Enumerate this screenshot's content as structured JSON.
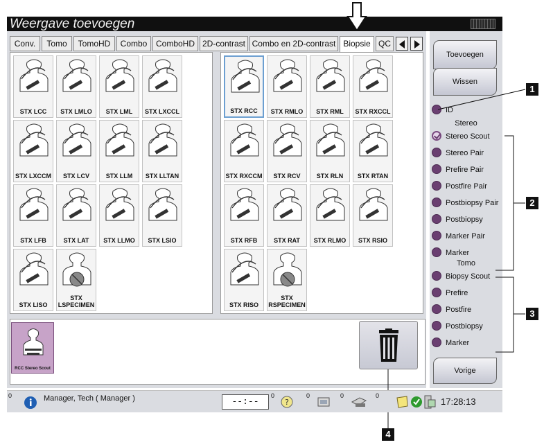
{
  "window": {
    "title": "Weergave toevoegen"
  },
  "tabs": [
    {
      "label": "Conv.",
      "active": false
    },
    {
      "label": "Tomo",
      "active": false
    },
    {
      "label": "TomoHD",
      "active": false
    },
    {
      "label": "Combo",
      "active": false
    },
    {
      "label": "ComboHD",
      "active": false
    },
    {
      "label": "2D-contrast",
      "active": false
    },
    {
      "label": "Combo en 2D-contrast",
      "active": false
    },
    {
      "label": "Biopsie",
      "active": true
    },
    {
      "label": "QC",
      "active": false
    }
  ],
  "left_views": [
    {
      "label": "STX LCC",
      "icon": "breast-compression-cc-icon"
    },
    {
      "label": "STX LMLO",
      "icon": "breast-compression-mlo-icon"
    },
    {
      "label": "STX LML",
      "icon": "breast-compression-ml-icon"
    },
    {
      "label": "STX LXCCL",
      "icon": "breast-compression-xccl-icon"
    },
    {
      "label": "STX LXCCM",
      "icon": "breast-compression-xccm-icon"
    },
    {
      "label": "STX LCV",
      "icon": "breast-compression-cv-icon"
    },
    {
      "label": "STX LLM",
      "icon": "breast-compression-lm-icon"
    },
    {
      "label": "STX LLTAN",
      "icon": "breast-compression-tan-icon"
    },
    {
      "label": "STX LFB",
      "icon": "breast-compression-fb-icon"
    },
    {
      "label": "STX LAT",
      "icon": "breast-compression-lat-icon"
    },
    {
      "label": "STX LLMO",
      "icon": "breast-compression-lmo-icon"
    },
    {
      "label": "STX LSIO",
      "icon": "breast-compression-sio-icon"
    },
    {
      "label": "STX LISO",
      "icon": "breast-compression-iso-icon"
    },
    {
      "label": "STX LSPECIMEN",
      "icon": "specimen-icon"
    }
  ],
  "right_views": [
    {
      "label": "STX RCC",
      "icon": "breast-compression-cc-icon",
      "selected": true
    },
    {
      "label": "STX RMLO",
      "icon": "breast-compression-mlo-icon"
    },
    {
      "label": "STX RML",
      "icon": "breast-compression-ml-icon"
    },
    {
      "label": "STX RXCCL",
      "icon": "breast-compression-xccl-icon"
    },
    {
      "label": "STX RXCCM",
      "icon": "breast-compression-xccm-icon"
    },
    {
      "label": "STX RCV",
      "icon": "breast-compression-cv-icon"
    },
    {
      "label": "STX RLN",
      "icon": "breast-compression-lm-icon"
    },
    {
      "label": "STX RTAN",
      "icon": "breast-compression-tan-icon"
    },
    {
      "label": "STX RFB",
      "icon": "breast-compression-fb-icon"
    },
    {
      "label": "STX RAT",
      "icon": "breast-compression-lat-icon"
    },
    {
      "label": "STX RLMO",
      "icon": "breast-compression-lmo-icon"
    },
    {
      "label": "STX RSIO",
      "icon": "breast-compression-sio-icon"
    },
    {
      "label": "STX RISO",
      "icon": "breast-compression-iso-icon"
    },
    {
      "label": "STX RSPECIMEN",
      "icon": "specimen-icon"
    }
  ],
  "added_view": {
    "label": "RCC Stereo Scout"
  },
  "buttons": {
    "add": "Toevoegen",
    "clear": "Wissen",
    "back": "Vorige"
  },
  "options": {
    "id_label": "ID",
    "stereo_header": "Stereo",
    "stereo": [
      {
        "label": "Stereo Scout",
        "checked": true
      },
      {
        "label": "Stereo Pair",
        "checked": false
      },
      {
        "label": "Prefire Pair",
        "checked": false
      },
      {
        "label": "Postfire Pair",
        "checked": false
      },
      {
        "label": "Postbiopsy Pair",
        "checked": false
      },
      {
        "label": "Postbiopsy",
        "checked": false
      },
      {
        "label": "Marker Pair",
        "checked": false
      },
      {
        "label": "Marker",
        "checked": false
      }
    ],
    "tomo_header": "Tomo",
    "tomo": [
      {
        "label": "Biopsy Scout",
        "checked": false
      },
      {
        "label": "Prefire",
        "checked": false
      },
      {
        "label": "Postfire",
        "checked": false
      },
      {
        "label": "Postbiopsy",
        "checked": false
      },
      {
        "label": "Marker",
        "checked": false
      }
    ]
  },
  "status": {
    "info_count": "0",
    "user": "Manager, Tech ( Manager )",
    "timer": "--:--",
    "help_count": "0",
    "queue_count": "0",
    "device_count": "0",
    "misc_count": "0",
    "time": "17:28:13"
  },
  "callouts": [
    "1",
    "2",
    "3",
    "4"
  ]
}
